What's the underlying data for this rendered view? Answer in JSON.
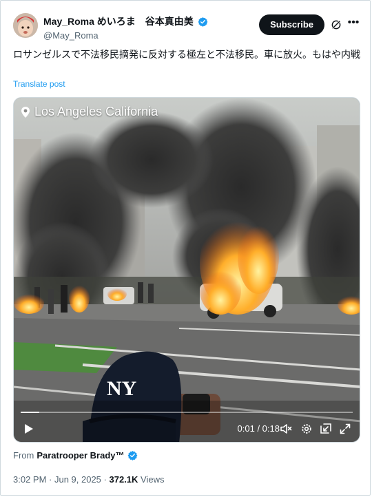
{
  "author": {
    "display_name": "May_Roma めいろま　谷本真由美",
    "handle": "@May_Roma"
  },
  "actions": {
    "subscribe_label": "Subscribe",
    "grok_icon": "grok-icon",
    "more_icon": "more-icon"
  },
  "post": {
    "text": "ロサンゼルスで不法移民摘発に反対する極左と不法移民。車に放火。もはや内戦",
    "translate_label": "Translate post"
  },
  "video": {
    "location_overlay": "Los Angeles California",
    "time_display": "0:01 / 0:18",
    "progress_fraction": 0.055,
    "cap_text": "NY"
  },
  "source": {
    "from_prefix": "From",
    "name": "Paratrooper Brady™"
  },
  "meta": {
    "timestamp": "3:02 PM · Jun 9, 2025",
    "separator": " · ",
    "views_count": "372.1K",
    "views_label": " Views"
  },
  "colors": {
    "link": "#1d9bf0",
    "verified": "#1d9bf0",
    "subscribe_bg": "#0f1419"
  }
}
